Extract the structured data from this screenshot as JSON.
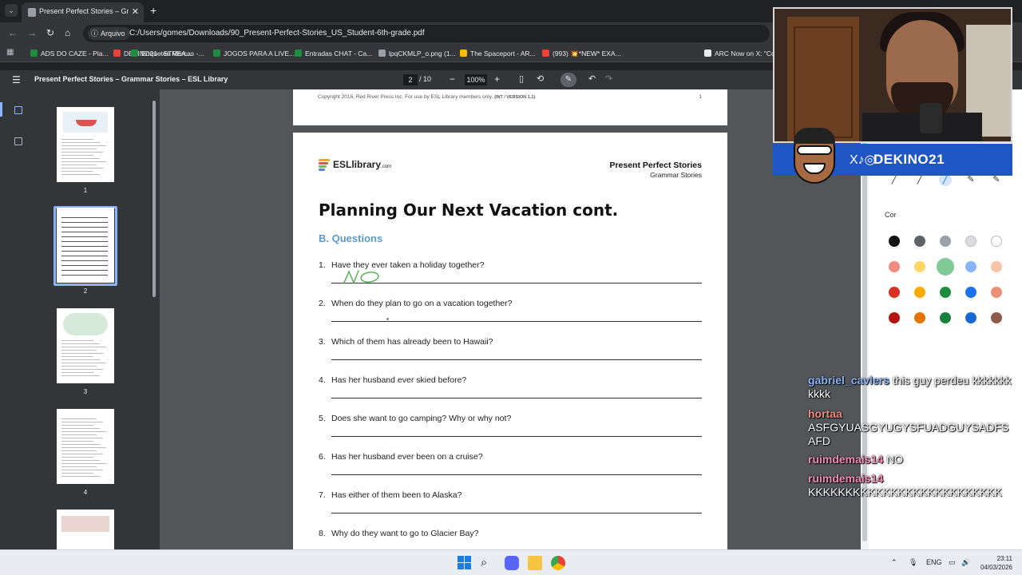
{
  "browser": {
    "tab_title": "Present Perfect Stories – Gramm",
    "tab_close": "✕",
    "new_tab": "+",
    "file_chip": "Arquivo",
    "url": "C:/Users/gomes/Downloads/90_Present-Perfect-Stories_US_Student-6th-grade.pdf",
    "bookmarks": [
      {
        "label": "ADS DO CAZE - Pla...",
        "color": "#1e8e3e"
      },
      {
        "label": "DEKINO21 - STREA...",
        "color": "#ea4335"
      },
      {
        "label": "Enquetes Marcas -...",
        "color": "#1e8e3e"
      },
      {
        "label": "JOGOS PARA A LIVE...",
        "color": "#1e8e3e"
      },
      {
        "label": "Entradas CHAT - Ca...",
        "color": "#1e8e3e"
      },
      {
        "label": "lpqCKMLP_o.png (1...",
        "color": "#9aa0a6"
      },
      {
        "label": "The Spaceport - AR...",
        "color": "#fbbc04"
      },
      {
        "label": "(993) 💥*NEW* EXA...",
        "color": "#ea4335"
      },
      {
        "label": "ARC Now on X: \"Co...",
        "color": "#e8eaed"
      }
    ]
  },
  "pdf_toolbar": {
    "doc_title": "Present Perfect Stories – Grammar Stories – ESL Library",
    "page_current": "2",
    "page_total": "/ 10",
    "zoom": "100%",
    "minus": "−",
    "plus": "+"
  },
  "thumbnails": [
    {
      "num": "1",
      "selected": false
    },
    {
      "num": "2",
      "selected": true
    },
    {
      "num": "3",
      "selected": false
    },
    {
      "num": "4",
      "selected": false
    }
  ],
  "page1": {
    "copyright": "Copyright 2016, Red River Press Inc. For use by ESL Library members only.",
    "version": "(INT / VERSION 1.1)",
    "page_number": "1"
  },
  "page2": {
    "logo_text": "ESLlibrary",
    "logo_suffix": ".com",
    "header_title": "Present Perfect Stories",
    "header_subtitle": "Grammar Stories",
    "title": "Planning Our Next Vacation cont.",
    "section": "B. Questions",
    "handwritten_answer": "NO",
    "questions": [
      {
        "n": "1.",
        "text": "Have they ever taken a holiday together?"
      },
      {
        "n": "2.",
        "text": "When do they plan to go on a vacation together?"
      },
      {
        "n": "3.",
        "text": "Which of them has already been to Hawaii?"
      },
      {
        "n": "4.",
        "text": "Has her husband ever skied before?"
      },
      {
        "n": "5.",
        "text": "Does she want to go camping? Why or why not?"
      },
      {
        "n": "6.",
        "text": "Has her husband ever been on a cruise?"
      },
      {
        "n": "7.",
        "text": "Has either of them been to Alaska?"
      },
      {
        "n": "8.",
        "text": "Why do they want to go to Glacier Bay?"
      }
    ]
  },
  "annotation_panel": {
    "color_label": "Cor",
    "colors": [
      "#111111",
      "#5f6368",
      "#9aa0a6",
      "#dadce0",
      "#ffffff",
      "#f28b82",
      "#fdd663",
      "#81c995",
      "#8ab4f8",
      "#f6c4a8",
      "#d93025",
      "#f9ab00",
      "#1e8e3e",
      "#1a73e8",
      "#e8907a",
      "#b31412",
      "#e37400",
      "#188038",
      "#1967d2",
      "#8d5b4c"
    ]
  },
  "stream_overlay": {
    "brand": "DEKINO21",
    "social_icons": "X♪◎"
  },
  "chat": [
    {
      "user": "gabriel_cavlers",
      "color": "#8ab4f8",
      "msg": "this guy perdeu kkkkkkkkkkk"
    },
    {
      "user": "hortaa",
      "color": "#f28b82",
      "msg": "ASFGYUASGYUGYSFUADGUYSADFSAFD"
    },
    {
      "user": "ruimdemais14",
      "color": "#f28bb1",
      "msg": "NO"
    },
    {
      "user": "ruimdemais14",
      "color": "#f28bb1",
      "msg": "KKKKKKKKKKKKKKKKKKKKKKKKKK"
    }
  ],
  "taskbar": {
    "lang": "ENG",
    "time": "23:11",
    "date": "04/03/2026",
    "chevron": "⌃"
  }
}
